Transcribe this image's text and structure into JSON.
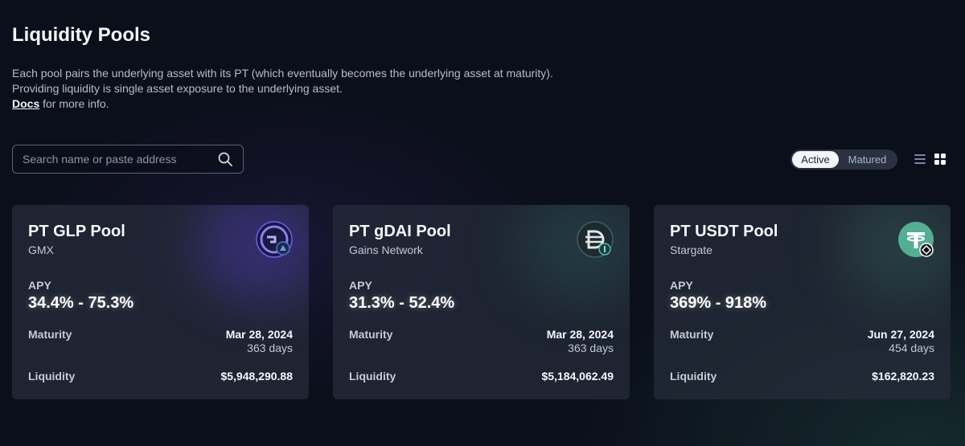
{
  "page": {
    "title": "Liquidity Pools",
    "description_line1": "Each pool pairs the underlying asset with its PT (which eventually becomes the underlying asset at maturity).",
    "description_line2": "Providing liquidity is single asset exposure to the underlying asset.",
    "docs_link": "Docs",
    "docs_suffix": " for more info."
  },
  "search": {
    "placeholder": "Search name or paste address",
    "value": ""
  },
  "filter": {
    "active_label": "Active",
    "matured_label": "Matured",
    "selected": "Active"
  },
  "view": {
    "list_icon": "list-icon",
    "grid_icon": "grid-icon",
    "selected": "grid"
  },
  "pools": [
    {
      "name": "PT GLP Pool",
      "protocol": "GMX",
      "logo_icon": "gmx-logo-icon",
      "apy_label": "APY",
      "apy": "34.4% - 75.3%",
      "maturity_label": "Maturity",
      "maturity_date": "Mar 28, 2024",
      "maturity_days": "363 days",
      "liquidity_label": "Liquidity",
      "liquidity": "$5,948,290.88",
      "glow_color": "#5a3fd0"
    },
    {
      "name": "PT gDAI Pool",
      "protocol": "Gains Network",
      "logo_icon": "dai-logo-icon",
      "apy_label": "APY",
      "apy": "31.3% - 52.4%",
      "maturity_label": "Maturity",
      "maturity_date": "Mar 28, 2024",
      "maturity_days": "363 days",
      "liquidity_label": "Liquidity",
      "liquidity": "$5,184,062.49",
      "glow_color": "#2f6d6a"
    },
    {
      "name": "PT USDT Pool",
      "protocol": "Stargate",
      "logo_icon": "tether-logo-icon",
      "apy_label": "APY",
      "apy": "369% - 918%",
      "maturity_label": "Maturity",
      "maturity_date": "Jun 27, 2024",
      "maturity_days": "454 days",
      "liquidity_label": "Liquidity",
      "liquidity": "$162,820.23",
      "glow_color": "#3d7a68"
    }
  ],
  "colors": {
    "background": "#0b0f1a",
    "card": "#262c3a",
    "tether_green": "#53ae94"
  }
}
